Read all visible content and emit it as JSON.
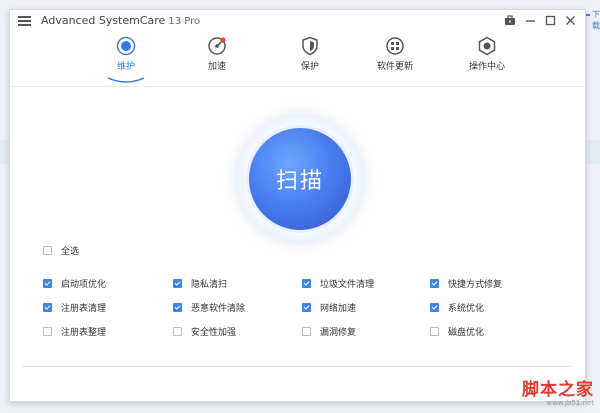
{
  "window": {
    "title": "Advanced SystemCare",
    "version": "13 Pro"
  },
  "background": {
    "link_fragment": "下载"
  },
  "nav": {
    "items": [
      {
        "label": "维护",
        "icon": "maintenance-icon",
        "active": true
      },
      {
        "label": "加速",
        "icon": "speedometer-icon",
        "active": false
      },
      {
        "label": "保护",
        "icon": "shield-icon",
        "active": false
      },
      {
        "label": "软件更新",
        "icon": "software-update-icon",
        "active": false
      },
      {
        "label": "操作中心",
        "icon": "action-center-icon",
        "active": false
      }
    ]
  },
  "scan": {
    "label": "扫描"
  },
  "select_all": {
    "label": "全选",
    "checked": false
  },
  "options": [
    [
      {
        "label": "启动项优化",
        "checked": true
      },
      {
        "label": "隐私清扫",
        "checked": true
      },
      {
        "label": "垃圾文件清理",
        "checked": true
      },
      {
        "label": "快捷方式修复",
        "checked": true
      }
    ],
    [
      {
        "label": "注册表清理",
        "checked": true
      },
      {
        "label": "恶意软件清除",
        "checked": true
      },
      {
        "label": "网络加速",
        "checked": true
      },
      {
        "label": "系统优化",
        "checked": true
      }
    ],
    [
      {
        "label": "注册表整理",
        "checked": false
      },
      {
        "label": "安全性加强",
        "checked": false
      },
      {
        "label": "漏洞修复",
        "checked": false
      },
      {
        "label": "磁盘优化",
        "checked": false
      }
    ]
  ],
  "watermark": {
    "main": "脚本之家",
    "sub": "www.jb51.net"
  },
  "colors": {
    "accent": "#2f7be0",
    "checkbox": "#3b86e5",
    "scan_button": "#4a7ff0",
    "watermark": "#e23b2e"
  }
}
